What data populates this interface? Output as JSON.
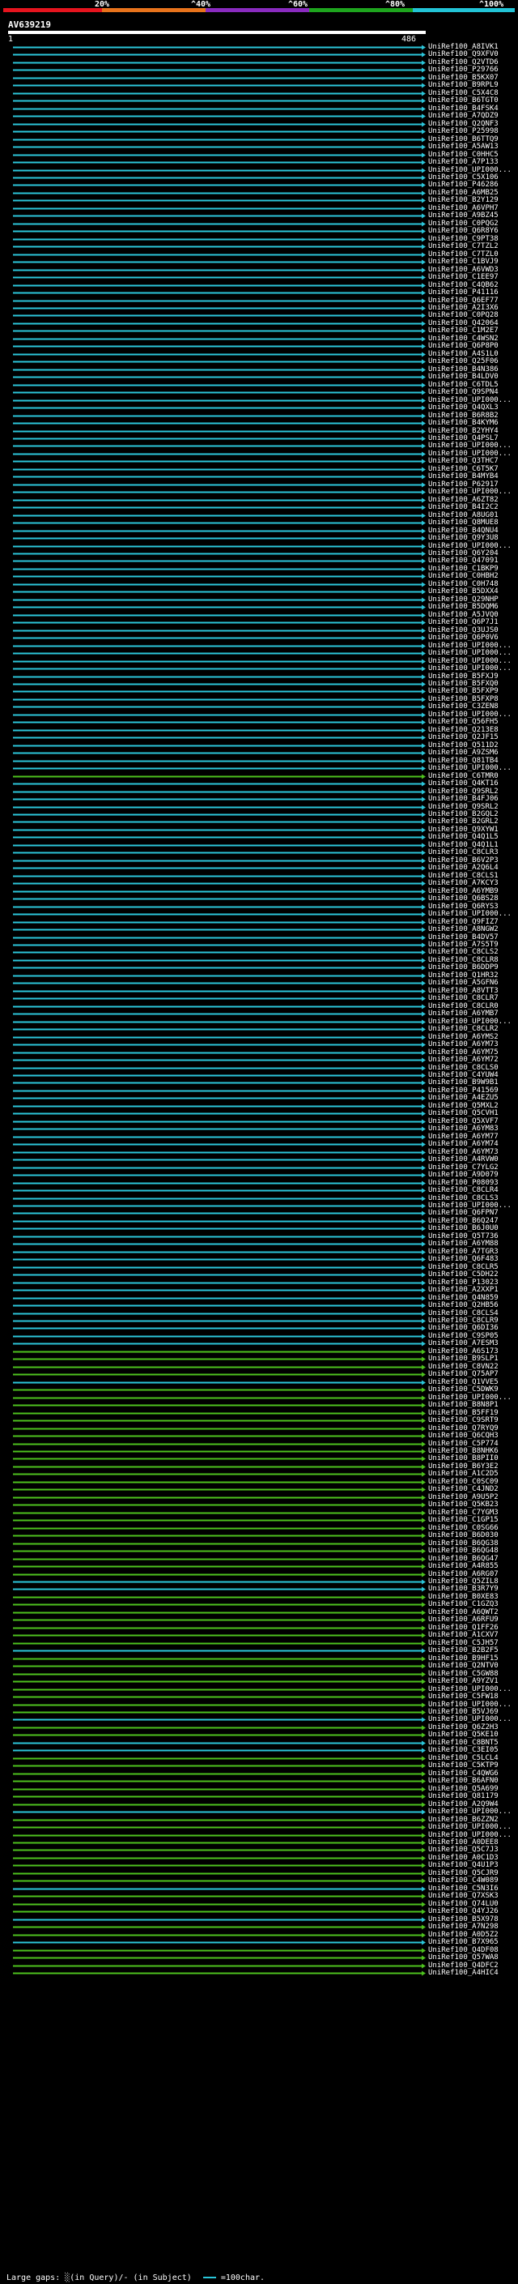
{
  "scale": {
    "ticks": [
      "20%",
      "^40%",
      "^60%",
      "^80%",
      "^100%"
    ],
    "colors": [
      "#e6141e",
      "#e8731c",
      "#8a2bbf",
      "#1ea51e",
      "#22c3d6"
    ]
  },
  "query": {
    "name": "AV639219",
    "start": "1",
    "end": "486"
  },
  "colors": {
    "cyan": "#2cc6da",
    "green": "#4ec21e"
  },
  "hits": [
    {
      "label": "UniRef100_A8IVK1",
      "color": "cyan"
    },
    {
      "label": "UniRef100_Q9XFV0",
      "color": "cyan"
    },
    {
      "label": "UniRef100_Q2VTD6",
      "color": "cyan"
    },
    {
      "label": "UniRef100_P29766",
      "color": "cyan"
    },
    {
      "label": "UniRef100_B5KX07",
      "color": "cyan"
    },
    {
      "label": "UniRef100_B9RPL9",
      "color": "cyan"
    },
    {
      "label": "UniRef100_C5X4C8",
      "color": "cyan"
    },
    {
      "label": "UniRef100_B6TGT0",
      "color": "cyan"
    },
    {
      "label": "UniRef100_B4FSK4",
      "color": "cyan"
    },
    {
      "label": "UniRef100_A7QDZ9",
      "color": "cyan"
    },
    {
      "label": "UniRef100_Q2QNF3",
      "color": "cyan"
    },
    {
      "label": "UniRef100_P25998",
      "color": "cyan"
    },
    {
      "label": "UniRef100_B6TTQ9",
      "color": "cyan"
    },
    {
      "label": "UniRef100_A5AW13",
      "color": "cyan"
    },
    {
      "label": "UniRef100_C0HHC5",
      "color": "cyan"
    },
    {
      "label": "UniRef100_A7P133",
      "color": "cyan"
    },
    {
      "label": "UniRef100_UPI000...",
      "color": "cyan"
    },
    {
      "label": "UniRef100_C5X106",
      "color": "cyan"
    },
    {
      "label": "UniRef100_P46286",
      "color": "cyan"
    },
    {
      "label": "UniRef100_A6MB25",
      "color": "cyan"
    },
    {
      "label": "UniRef100_B2Y129",
      "color": "cyan"
    },
    {
      "label": "UniRef100_A6VPH7",
      "color": "cyan"
    },
    {
      "label": "UniRef100_A9BZ45",
      "color": "cyan"
    },
    {
      "label": "UniRef100_C0PQG2",
      "color": "cyan"
    },
    {
      "label": "UniRef100_Q6R8Y6",
      "color": "cyan"
    },
    {
      "label": "UniRef100_C9PT38",
      "color": "cyan"
    },
    {
      "label": "UniRef100_C7TZL2",
      "color": "cyan"
    },
    {
      "label": "UniRef100_C7TZL0",
      "color": "cyan"
    },
    {
      "label": "UniRef100_C1BVJ9",
      "color": "cyan"
    },
    {
      "label": "UniRef100_A6VWD3",
      "color": "cyan"
    },
    {
      "label": "UniRef100_C1EE97",
      "color": "cyan"
    },
    {
      "label": "UniRef100_C4QB62",
      "color": "cyan"
    },
    {
      "label": "UniRef100_P41116",
      "color": "cyan"
    },
    {
      "label": "UniRef100_Q6EF77",
      "color": "cyan"
    },
    {
      "label": "UniRef100_A2I3X6",
      "color": "cyan"
    },
    {
      "label": "UniRef100_C0PQ28",
      "color": "cyan"
    },
    {
      "label": "UniRef100_Q42064",
      "color": "cyan"
    },
    {
      "label": "UniRef100_C1M2E7",
      "color": "cyan"
    },
    {
      "label": "UniRef100_C4WSN2",
      "color": "cyan"
    },
    {
      "label": "UniRef100_Q6P8P0",
      "color": "cyan"
    },
    {
      "label": "UniRef100_A4S1L0",
      "color": "cyan"
    },
    {
      "label": "UniRef100_Q25F06",
      "color": "cyan"
    },
    {
      "label": "UniRef100_B4N386",
      "color": "cyan"
    },
    {
      "label": "UniRef100_B4LDV0",
      "color": "cyan"
    },
    {
      "label": "UniRef100_C6TDL5",
      "color": "cyan"
    },
    {
      "label": "UniRef100_Q9SPN4",
      "color": "cyan"
    },
    {
      "label": "UniRef100_UPI000...",
      "color": "cyan"
    },
    {
      "label": "UniRef100_Q4QXL3",
      "color": "cyan"
    },
    {
      "label": "UniRef100_B6R8B2",
      "color": "cyan"
    },
    {
      "label": "UniRef100_B4KYM6",
      "color": "cyan"
    },
    {
      "label": "UniRef100_B2YHY4",
      "color": "cyan"
    },
    {
      "label": "UniRef100_Q4PSL7",
      "color": "cyan"
    },
    {
      "label": "UniRef100_UPI000...",
      "color": "cyan"
    },
    {
      "label": "UniRef100_UPI000...",
      "color": "cyan"
    },
    {
      "label": "UniRef100_Q3THC7",
      "color": "cyan"
    },
    {
      "label": "UniRef100_C6T5K7",
      "color": "cyan"
    },
    {
      "label": "UniRef100_B4MYB4",
      "color": "cyan"
    },
    {
      "label": "UniRef100_P62917",
      "color": "cyan"
    },
    {
      "label": "UniRef100_UPI000...",
      "color": "cyan"
    },
    {
      "label": "UniRef100_A6ZT82",
      "color": "cyan"
    },
    {
      "label": "UniRef100_B4I2C2",
      "color": "cyan"
    },
    {
      "label": "UniRef100_A8UG01",
      "color": "cyan"
    },
    {
      "label": "UniRef100_Q8MUE8",
      "color": "cyan"
    },
    {
      "label": "UniRef100_B4QNU4",
      "color": "cyan"
    },
    {
      "label": "UniRef100_Q9Y3U8",
      "color": "cyan"
    },
    {
      "label": "UniRef100_UPI000...",
      "color": "cyan"
    },
    {
      "label": "UniRef100_Q6Y204",
      "color": "cyan"
    },
    {
      "label": "UniRef100_Q47091",
      "color": "cyan"
    },
    {
      "label": "UniRef100_C1BKP9",
      "color": "cyan"
    },
    {
      "label": "UniRef100_C0HBH2",
      "color": "cyan"
    },
    {
      "label": "UniRef100_C0H748",
      "color": "cyan"
    },
    {
      "label": "UniRef100_B5DXX4",
      "color": "cyan"
    },
    {
      "label": "UniRef100_Q29NHP",
      "color": "cyan"
    },
    {
      "label": "UniRef100_B5DQM6",
      "color": "cyan"
    },
    {
      "label": "UniRef100_A5JVQ0",
      "color": "cyan"
    },
    {
      "label": "UniRef100_Q6P7J1",
      "color": "cyan"
    },
    {
      "label": "UniRef100_Q3UJS0",
      "color": "cyan"
    },
    {
      "label": "UniRef100_Q6P0V6",
      "color": "cyan"
    },
    {
      "label": "UniRef100_UPI000...",
      "color": "cyan"
    },
    {
      "label": "UniRef100_UPI000...",
      "color": "cyan"
    },
    {
      "label": "UniRef100_UPI000...",
      "color": "cyan"
    },
    {
      "label": "UniRef100_UPI000...",
      "color": "cyan"
    },
    {
      "label": "UniRef100_B5FXJ9",
      "color": "cyan"
    },
    {
      "label": "UniRef100_B5FXQ0",
      "color": "cyan"
    },
    {
      "label": "UniRef100_B5FXP9",
      "color": "cyan"
    },
    {
      "label": "UniRef100_B5FXP8",
      "color": "cyan"
    },
    {
      "label": "UniRef100_C3ZEN8",
      "color": "cyan"
    },
    {
      "label": "UniRef100_UPI000...",
      "color": "cyan"
    },
    {
      "label": "UniRef100_Q56FH5",
      "color": "cyan"
    },
    {
      "label": "UniRef100_Q213E8",
      "color": "cyan"
    },
    {
      "label": "UniRef100_Q2JF15",
      "color": "cyan"
    },
    {
      "label": "UniRef100_Q511D2",
      "color": "cyan"
    },
    {
      "label": "UniRef100_A9ZSM6",
      "color": "cyan"
    },
    {
      "label": "UniRef100_Q81TB4",
      "color": "cyan"
    },
    {
      "label": "UniRef100_UPI000...",
      "color": "cyan"
    },
    {
      "label": "UniRef100_C6TMR0",
      "color": "green"
    },
    {
      "label": "UniRef100_Q4KT16",
      "color": "cyan"
    },
    {
      "label": "UniRef100_Q9SRL2",
      "color": "cyan"
    },
    {
      "label": "UniRef100_B4FJ06",
      "color": "cyan"
    },
    {
      "label": "UniRef100_Q9SRL2",
      "color": "cyan"
    },
    {
      "label": "UniRef100_B2GQL2",
      "color": "cyan"
    },
    {
      "label": "UniRef100_B2GRL2",
      "color": "cyan"
    },
    {
      "label": "UniRef100_Q9XYW1",
      "color": "cyan"
    },
    {
      "label": "UniRef100_Q4Q1L5",
      "color": "cyan"
    },
    {
      "label": "UniRef100_Q4Q1L1",
      "color": "cyan"
    },
    {
      "label": "UniRef100_C8CLR3",
      "color": "cyan"
    },
    {
      "label": "UniRef100_B6V2P3",
      "color": "cyan"
    },
    {
      "label": "UniRef100_A2Q6L4",
      "color": "cyan"
    },
    {
      "label": "UniRef100_C8CLS1",
      "color": "cyan"
    },
    {
      "label": "UniRef100_A7KCY3",
      "color": "cyan"
    },
    {
      "label": "UniRef100_A6YMB9",
      "color": "cyan"
    },
    {
      "label": "UniRef100_Q6BS28",
      "color": "cyan"
    },
    {
      "label": "UniRef100_Q6RYS3",
      "color": "cyan"
    },
    {
      "label": "UniRef100_UPI000...",
      "color": "cyan"
    },
    {
      "label": "UniRef100_Q9FIZ7",
      "color": "cyan"
    },
    {
      "label": "UniRef100_A8NGW2",
      "color": "cyan"
    },
    {
      "label": "UniRef100_B4DV57",
      "color": "cyan"
    },
    {
      "label": "UniRef100_A7S5T9",
      "color": "cyan"
    },
    {
      "label": "UniRef100_C8CLS2",
      "color": "cyan"
    },
    {
      "label": "UniRef100_C8CLR8",
      "color": "cyan"
    },
    {
      "label": "UniRef100_B6DDP9",
      "color": "cyan"
    },
    {
      "label": "UniRef100_Q1HR32",
      "color": "cyan"
    },
    {
      "label": "UniRef100_A5GFN6",
      "color": "cyan"
    },
    {
      "label": "UniRef100_A8VTT3",
      "color": "cyan"
    },
    {
      "label": "UniRef100_C8CLR7",
      "color": "cyan"
    },
    {
      "label": "UniRef100_C8CLR0",
      "color": "cyan"
    },
    {
      "label": "UniRef100_A6YMB7",
      "color": "cyan"
    },
    {
      "label": "UniRef100_UPI000...",
      "color": "cyan"
    },
    {
      "label": "UniRef100_C8CLR2",
      "color": "cyan"
    },
    {
      "label": "UniRef100_A6YMS2",
      "color": "cyan"
    },
    {
      "label": "UniRef100_A6YM73",
      "color": "cyan"
    },
    {
      "label": "UniRef100_A6YM75",
      "color": "cyan"
    },
    {
      "label": "UniRef100_A6YM72",
      "color": "cyan"
    },
    {
      "label": "UniRef100_C8CLS0",
      "color": "cyan"
    },
    {
      "label": "UniRef100_C4YUW4",
      "color": "cyan"
    },
    {
      "label": "UniRef100_B9W9B1",
      "color": "cyan"
    },
    {
      "label": "UniRef100_P41569",
      "color": "cyan"
    },
    {
      "label": "UniRef100_A4EZU5",
      "color": "cyan"
    },
    {
      "label": "UniRef100_Q5MXL2",
      "color": "cyan"
    },
    {
      "label": "UniRef100_Q5CVH1",
      "color": "cyan"
    },
    {
      "label": "UniRef100_Q5XVF7",
      "color": "cyan"
    },
    {
      "label": "UniRef100_A6YM83",
      "color": "cyan"
    },
    {
      "label": "UniRef100_A6YM77",
      "color": "cyan"
    },
    {
      "label": "UniRef100_A6YM74",
      "color": "cyan"
    },
    {
      "label": "UniRef100_A6YM73",
      "color": "cyan"
    },
    {
      "label": "UniRef100_A4RVW0",
      "color": "cyan"
    },
    {
      "label": "UniRef100_C7YLG2",
      "color": "cyan"
    },
    {
      "label": "UniRef100_A9D079",
      "color": "cyan"
    },
    {
      "label": "UniRef100_P08093",
      "color": "cyan"
    },
    {
      "label": "UniRef100_C8CLR4",
      "color": "cyan"
    },
    {
      "label": "UniRef100_C8CLS3",
      "color": "cyan"
    },
    {
      "label": "UniRef100_UPI000...",
      "color": "cyan"
    },
    {
      "label": "UniRef100_Q6FPN7",
      "color": "cyan"
    },
    {
      "label": "UniRef100_B6Q247",
      "color": "cyan"
    },
    {
      "label": "UniRef100_B6J0U0",
      "color": "cyan"
    },
    {
      "label": "UniRef100_Q5T736",
      "color": "cyan"
    },
    {
      "label": "UniRef100_A6YM88",
      "color": "cyan"
    },
    {
      "label": "UniRef100_A7TGR3",
      "color": "cyan"
    },
    {
      "label": "UniRef100_Q6F483",
      "color": "cyan"
    },
    {
      "label": "UniRef100_C8CLR5",
      "color": "cyan"
    },
    {
      "label": "UniRef100_C5DH22",
      "color": "cyan"
    },
    {
      "label": "UniRef100_P13023",
      "color": "cyan"
    },
    {
      "label": "UniRef100_A2XXP1",
      "color": "cyan"
    },
    {
      "label": "UniRef100_Q4N859",
      "color": "cyan"
    },
    {
      "label": "UniRef100_Q2HB56",
      "color": "cyan"
    },
    {
      "label": "UniRef100_C8CLS4",
      "color": "cyan"
    },
    {
      "label": "UniRef100_C8CLR9",
      "color": "cyan"
    },
    {
      "label": "UniRef100_Q6DI36",
      "color": "cyan"
    },
    {
      "label": "UniRef100_C9SP05",
      "color": "cyan"
    },
    {
      "label": "UniRef100_A7ESM3",
      "color": "cyan"
    },
    {
      "label": "UniRef100_A6S173",
      "color": "green"
    },
    {
      "label": "UniRef100_B9SLP1",
      "color": "green"
    },
    {
      "label": "UniRef100_C8VN22",
      "color": "green"
    },
    {
      "label": "UniRef100_Q75AP7",
      "color": "green"
    },
    {
      "label": "UniRef100_Q1VVE5",
      "color": "cyan"
    },
    {
      "label": "UniRef100_C5DWK9",
      "color": "green"
    },
    {
      "label": "UniRef100_UPI000...",
      "color": "green"
    },
    {
      "label": "UniRef100_B8N8P1",
      "color": "green"
    },
    {
      "label": "UniRef100_B5FF19",
      "color": "green"
    },
    {
      "label": "UniRef100_C9SRT9",
      "color": "green"
    },
    {
      "label": "UniRef100_Q7RYQ9",
      "color": "green"
    },
    {
      "label": "UniRef100_Q6CQH3",
      "color": "green"
    },
    {
      "label": "UniRef100_C5P774",
      "color": "green"
    },
    {
      "label": "UniRef100_B8NHK6",
      "color": "green"
    },
    {
      "label": "UniRef100_B8PII0",
      "color": "green"
    },
    {
      "label": "UniRef100_B6Y3E2",
      "color": "green"
    },
    {
      "label": "UniRef100_A1C2D5",
      "color": "green"
    },
    {
      "label": "UniRef100_C0SC09",
      "color": "green"
    },
    {
      "label": "UniRef100_C4JND2",
      "color": "green"
    },
    {
      "label": "UniRef100_A9U5P2",
      "color": "green"
    },
    {
      "label": "UniRef100_Q5KB23",
      "color": "green"
    },
    {
      "label": "UniRef100_C7YGM3",
      "color": "green"
    },
    {
      "label": "UniRef100_C1GP15",
      "color": "green"
    },
    {
      "label": "UniRef100_C0SG66",
      "color": "green"
    },
    {
      "label": "UniRef100_B6D030",
      "color": "green"
    },
    {
      "label": "UniRef100_B6QG38",
      "color": "green"
    },
    {
      "label": "UniRef100_B6QG48",
      "color": "green"
    },
    {
      "label": "UniRef100_B6QG47",
      "color": "green"
    },
    {
      "label": "UniRef100_A4R855",
      "color": "green"
    },
    {
      "label": "UniRef100_A6RG07",
      "color": "green"
    },
    {
      "label": "UniRef100_Q5ZIL8",
      "color": "cyan"
    },
    {
      "label": "UniRef100_B3R7Y9",
      "color": "cyan"
    },
    {
      "label": "UniRef100_B0XE83",
      "color": "green"
    },
    {
      "label": "UniRef100_C1GZQ3",
      "color": "green"
    },
    {
      "label": "UniRef100_A6QWT2",
      "color": "green"
    },
    {
      "label": "UniRef100_A6RFU9",
      "color": "green"
    },
    {
      "label": "UniRef100_Q1FF26",
      "color": "green"
    },
    {
      "label": "UniRef100_A1CXV7",
      "color": "green"
    },
    {
      "label": "UniRef100_C5JH57",
      "color": "green"
    },
    {
      "label": "UniRef100_B2B2F5",
      "color": "cyan"
    },
    {
      "label": "UniRef100_B9HF15",
      "color": "green"
    },
    {
      "label": "UniRef100_Q2NTV0",
      "color": "green"
    },
    {
      "label": "UniRef100_C5GW88",
      "color": "green"
    },
    {
      "label": "UniRef100_A9YZV1",
      "color": "green"
    },
    {
      "label": "UniRef100_UPI000...",
      "color": "green"
    },
    {
      "label": "UniRef100_C5FW18",
      "color": "green"
    },
    {
      "label": "UniRef100_UPI000...",
      "color": "green"
    },
    {
      "label": "UniRef100_B5VJ69",
      "color": "green"
    },
    {
      "label": "UniRef100_UPI000...",
      "color": "cyan"
    },
    {
      "label": "UniRef100_Q6Z2H3",
      "color": "green"
    },
    {
      "label": "UniRef100_Q5KE10",
      "color": "green"
    },
    {
      "label": "UniRef100_C8BNT5",
      "color": "cyan"
    },
    {
      "label": "UniRef100_C3EI05",
      "color": "cyan"
    },
    {
      "label": "UniRef100_C5LCL4",
      "color": "green"
    },
    {
      "label": "UniRef100_C5KTP9",
      "color": "green"
    },
    {
      "label": "UniRef100_C4QWG6",
      "color": "green"
    },
    {
      "label": "UniRef100_B6AFN0",
      "color": "green"
    },
    {
      "label": "UniRef100_Q5A699",
      "color": "green"
    },
    {
      "label": "UniRef100_Q81179",
      "color": "green"
    },
    {
      "label": "UniRef100_A2Q9W4",
      "color": "green"
    },
    {
      "label": "UniRef100_UPI000...",
      "color": "cyan"
    },
    {
      "label": "UniRef100_B6ZZN2",
      "color": "green"
    },
    {
      "label": "UniRef100_UPI000...",
      "color": "green"
    },
    {
      "label": "UniRef100_UPI000...",
      "color": "green"
    },
    {
      "label": "UniRef100_A0DEE8",
      "color": "green"
    },
    {
      "label": "UniRef100_Q5C7J3",
      "color": "green"
    },
    {
      "label": "UniRef100_A0C1D3",
      "color": "green"
    },
    {
      "label": "UniRef100_Q4U1P3",
      "color": "green"
    },
    {
      "label": "UniRef100_Q5CJR9",
      "color": "green"
    },
    {
      "label": "UniRef100_C4W089",
      "color": "green"
    },
    {
      "label": "UniRef100_C5N3I6",
      "color": "cyan"
    },
    {
      "label": "UniRef100_Q7XSK3",
      "color": "green"
    },
    {
      "label": "UniRef100_Q74LU0",
      "color": "green"
    },
    {
      "label": "UniRef100_Q4YJ26",
      "color": "green"
    },
    {
      "label": "UniRef100_B5X978",
      "color": "cyan"
    },
    {
      "label": "UniRef100_A7N298",
      "color": "green"
    },
    {
      "label": "UniRef100_A0D5Z2",
      "color": "green"
    },
    {
      "label": "UniRef100_B7X965",
      "color": "cyan"
    },
    {
      "label": "UniRef100_Q4DF08",
      "color": "green"
    },
    {
      "label": "UniRef100_Q57WA8",
      "color": "green"
    },
    {
      "label": "UniRef100_Q4DFC2",
      "color": "green"
    },
    {
      "label": "UniRef100_A4HIC4",
      "color": "green"
    }
  ],
  "legend": {
    "text": "Large gaps: ░(in Query)/- (in Subject)",
    "scale_text": "=100char."
  }
}
